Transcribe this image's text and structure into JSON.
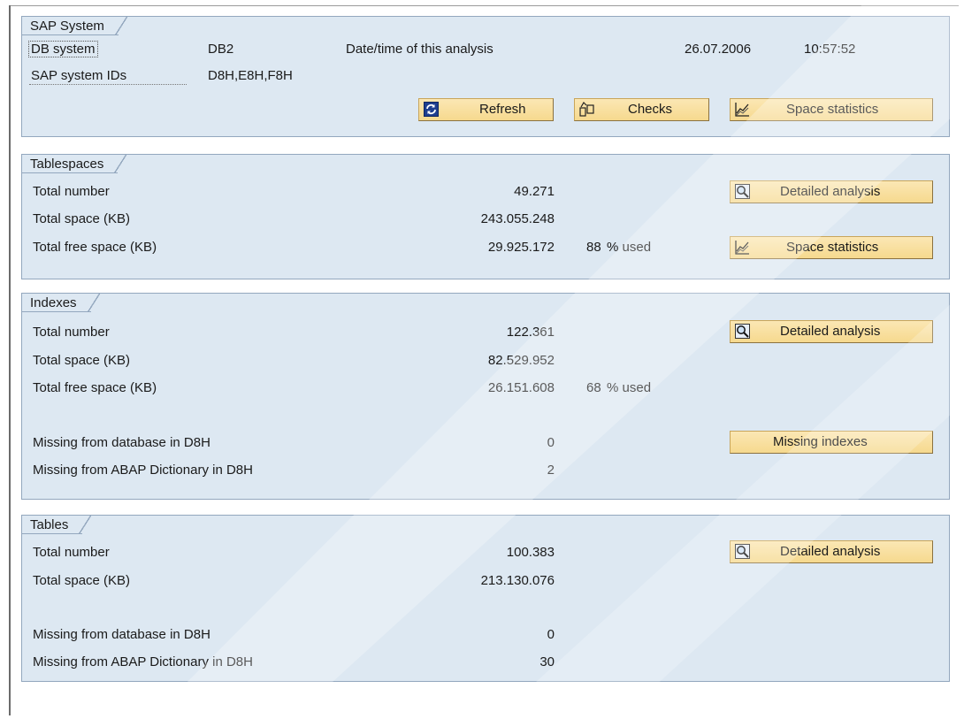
{
  "sap_system": {
    "title": "SAP System",
    "db_system_label": "DB system",
    "db_system_value": "DB2",
    "analysis_label": "Date/time of this analysis",
    "analysis_date": "26.07.2006",
    "analysis_time": "10:57:52",
    "system_ids_label": "SAP system IDs",
    "system_ids_value": "D8H,E8H,F8H",
    "refresh_label": "Refresh",
    "checks_label": "Checks",
    "space_stats_label": "Space statistics"
  },
  "tablespaces": {
    "title": "Tablespaces",
    "total_number_label": "Total number",
    "total_number": "49.271",
    "total_space_label": "Total space (KB)",
    "total_space": "243.055.248",
    "free_space_label": "Total free space (KB)",
    "free_space": "29.925.172",
    "used_pct": "88",
    "used_label": "% used",
    "detailed_label": "Detailed analysis",
    "space_stats_label": "Space statistics"
  },
  "indexes": {
    "title": "Indexes",
    "total_number_label": "Total number",
    "total_number": "122.361",
    "total_space_label": "Total space (KB)",
    "total_space": "82.529.952",
    "free_space_label": "Total free space (KB)",
    "free_space": "26.151.608",
    "used_pct": "68",
    "used_label": "% used",
    "missing_db_label": "Missing from database in D8H",
    "missing_db": "0",
    "missing_abap_label": "Missing from ABAP Dictionary in D8H",
    "missing_abap": "2",
    "detailed_label": "Detailed analysis",
    "missing_indexes_label": "Missing indexes"
  },
  "tables": {
    "title": "Tables",
    "total_number_label": "Total number",
    "total_number": "100.383",
    "total_space_label": "Total space (KB)",
    "total_space": "213.130.076",
    "missing_db_label": "Missing from database in D8H",
    "missing_db": "0",
    "missing_abap_label": "Missing from ABAP Dictionary in D8H",
    "missing_abap": "30",
    "detailed_label": "Detailed analysis"
  },
  "colors": {
    "group_bg": "#dde8f2",
    "group_border": "#93a7be",
    "button_bg": "#f6d98e"
  },
  "icons": {
    "refresh": "refresh-icon",
    "checks": "checks-icon",
    "space_statistics": "chart-icon",
    "detailed_analysis": "magnifier-icon"
  }
}
